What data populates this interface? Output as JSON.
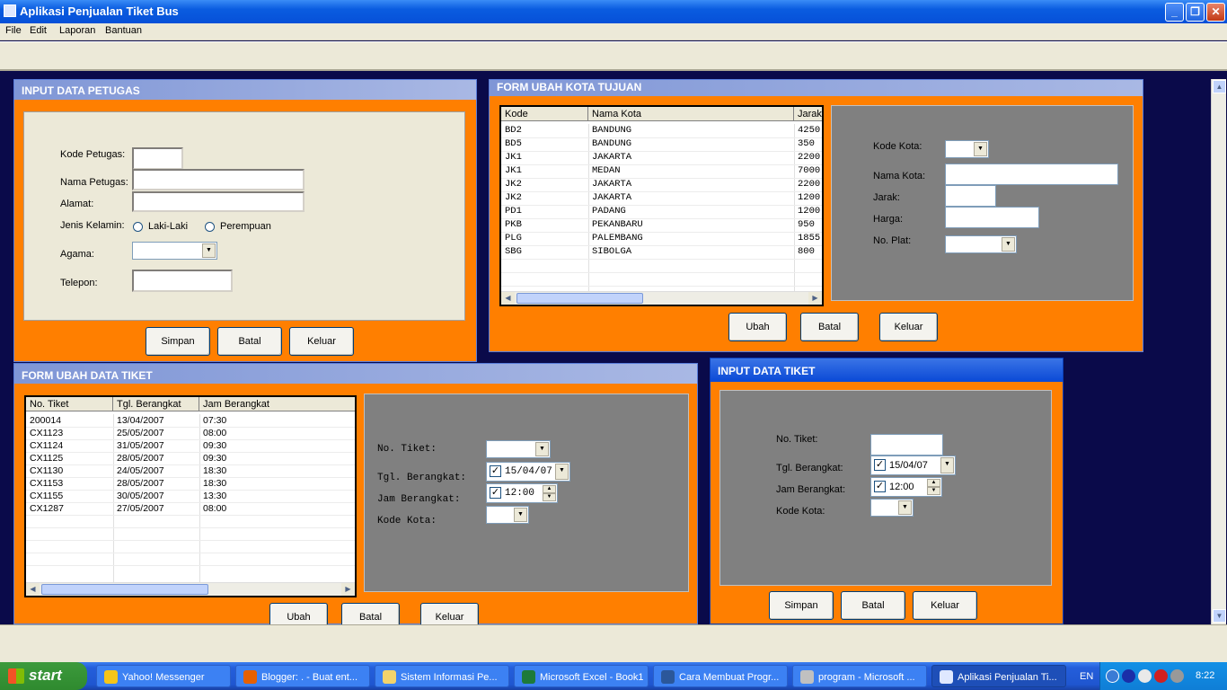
{
  "app": {
    "title": "Aplikasi Penjualan Tiket Bus",
    "window_buttons": [
      "minimize",
      "restore",
      "close"
    ]
  },
  "menu": [
    "File",
    "Edit",
    "Laporan",
    "Bantuan"
  ],
  "petugas": {
    "title": "INPUT DATA PETUGAS",
    "kode_label": "Kode Petugas:",
    "nama_label": "Nama Petugas:",
    "alamat_label": "Alamat:",
    "jk_label": "Jenis Kelamin:",
    "laki": "Laki-Laki",
    "perempuan": "Perempuan",
    "agama_label": "Agama:",
    "telepon_label": "Telepon:",
    "btn_simpan": "Simpan",
    "btn_batal": "Batal",
    "btn_keluar": "Keluar"
  },
  "kota": {
    "title": "FORM UBAH KOTA TUJUAN",
    "columns": [
      "Kode",
      "Nama Kota",
      "Jarak"
    ],
    "rows": [
      [
        "BD2",
        "BANDUNG",
        "4250"
      ],
      [
        "BD5",
        "BANDUNG",
        "350"
      ],
      [
        "JK1",
        "JAKARTA",
        "2200"
      ],
      [
        "JK1",
        "MEDAN",
        "7000"
      ],
      [
        "JK2",
        "JAKARTA",
        "2200"
      ],
      [
        "JK2",
        "JAKARTA",
        "1200"
      ],
      [
        "PD1",
        "PADANG",
        "1200"
      ],
      [
        "PKB",
        "PEKANBARU",
        "950"
      ],
      [
        "PLG",
        "PALEMBANG",
        "1855"
      ],
      [
        "SBG",
        "SIBOLGA",
        "800"
      ]
    ],
    "kode_label": "Kode Kota:",
    "nama_label": "Nama Kota:",
    "jarak_label": "Jarak:",
    "harga_label": "Harga:",
    "plat_label": "No. Plat:",
    "btn_ubah": "Ubah",
    "btn_batal": "Batal",
    "btn_keluar": "Keluar"
  },
  "ubah_tiket": {
    "title": "FORM UBAH DATA TIKET",
    "columns": [
      "No. Tiket",
      "Tgl. Berangkat",
      "Jam Berangkat"
    ],
    "rows": [
      [
        "200014",
        "13/04/2007",
        "07:30"
      ],
      [
        "CX1123",
        "25/05/2007",
        "08:00"
      ],
      [
        "CX1124",
        "31/05/2007",
        "09:30"
      ],
      [
        "CX1125",
        "28/05/2007",
        "09:30"
      ],
      [
        "CX1130",
        "24/05/2007",
        "18:30"
      ],
      [
        "CX1153",
        "28/05/2007",
        "18:30"
      ],
      [
        "CX1155",
        "30/05/2007",
        "13:30"
      ],
      [
        "CX1287",
        "27/05/2007",
        "08:00"
      ]
    ],
    "no_label": "No. Tiket:",
    "tgl_label": "Tgl. Berangkat:",
    "jam_label": "Jam Berangkat:",
    "kode_label": "Kode Kota:",
    "tgl_value": "15/04/07",
    "jam_value": "12:00",
    "btn_ubah": "Ubah",
    "btn_batal": "Batal",
    "btn_keluar": "Keluar"
  },
  "input_tiket": {
    "title": "INPUT DATA TIKET",
    "no_label": "No. Tiket:",
    "tgl_label": "Tgl. Berangkat:",
    "jam_label": "Jam Berangkat:",
    "kode_label": "Kode Kota:",
    "tgl_value": "15/04/07",
    "jam_value": "12:00",
    "btn_simpan": "Simpan",
    "btn_batal": "Batal",
    "btn_keluar": "Keluar"
  },
  "taskbar": {
    "start": "start",
    "tasks": [
      "Yahoo! Messenger",
      "Blogger: . - Buat ent...",
      "Sistem Informasi Pe...",
      "Microsoft Excel - Book1",
      "Cara Membuat Progr...",
      "program - Microsoft ...",
      "Aplikasi Penjualan Ti..."
    ],
    "lang": "EN",
    "clock": "8:22"
  },
  "colors": {
    "form_bg": "#ff7f00",
    "mdi_bg": "#0a0a4a",
    "panel_gray": "#808080",
    "taskbar": "#245edb"
  }
}
